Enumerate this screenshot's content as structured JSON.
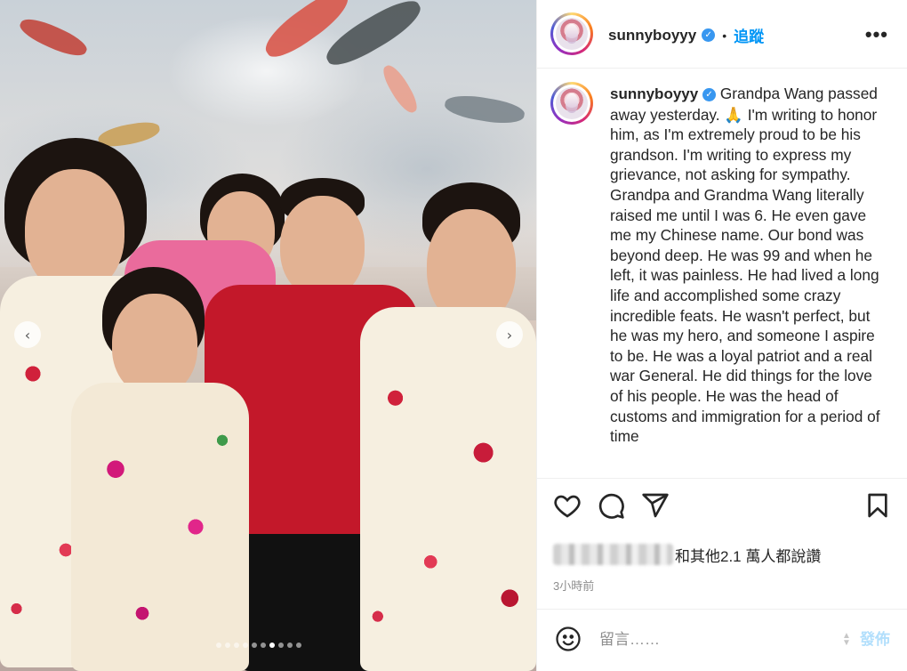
{
  "post": {
    "username": "sunnyboyyy",
    "verified_glyph": "✓",
    "separator": "•",
    "follow_label": "追蹤",
    "more_label": "•••",
    "caption": "Grandpa Wang passed away yesterday. 🙏 I'm writing to honor him, as I'm extremely proud to be his grandson. I'm writing to express my grievance, not asking for sympathy. Grandpa and Grandma Wang literally raised me until I was 6. He even gave me my Chinese name. Our bond was beyond deep. He was 99 and when he left, it was painless. He had lived a long life and accomplished some crazy incredible feats. He wasn't perfect, but he was my hero, and someone I aspire to be. He was a loyal patriot and a real war General. He did things for the love of his people. He was the head of customs and immigration for a period of time",
    "likes_text": "和其他2.1 萬人都說讚",
    "time_ago": "3小時前",
    "comment_placeholder": "留言……",
    "post_label": "發佈"
  },
  "carousel": {
    "total_slides": 10,
    "active_index": 6,
    "prev_arrow": "‹",
    "next_arrow": "›"
  },
  "icons": [
    "heart-icon",
    "comment-icon",
    "share-icon",
    "bookmark-icon",
    "emoji-icon",
    "verified-badge-icon",
    "more-options-icon"
  ],
  "colors": {
    "link_blue": "#0095f6",
    "verified_blue": "#3897f0",
    "muted_text": "#8e8e8e",
    "post_disabled": "#b2dffc"
  }
}
